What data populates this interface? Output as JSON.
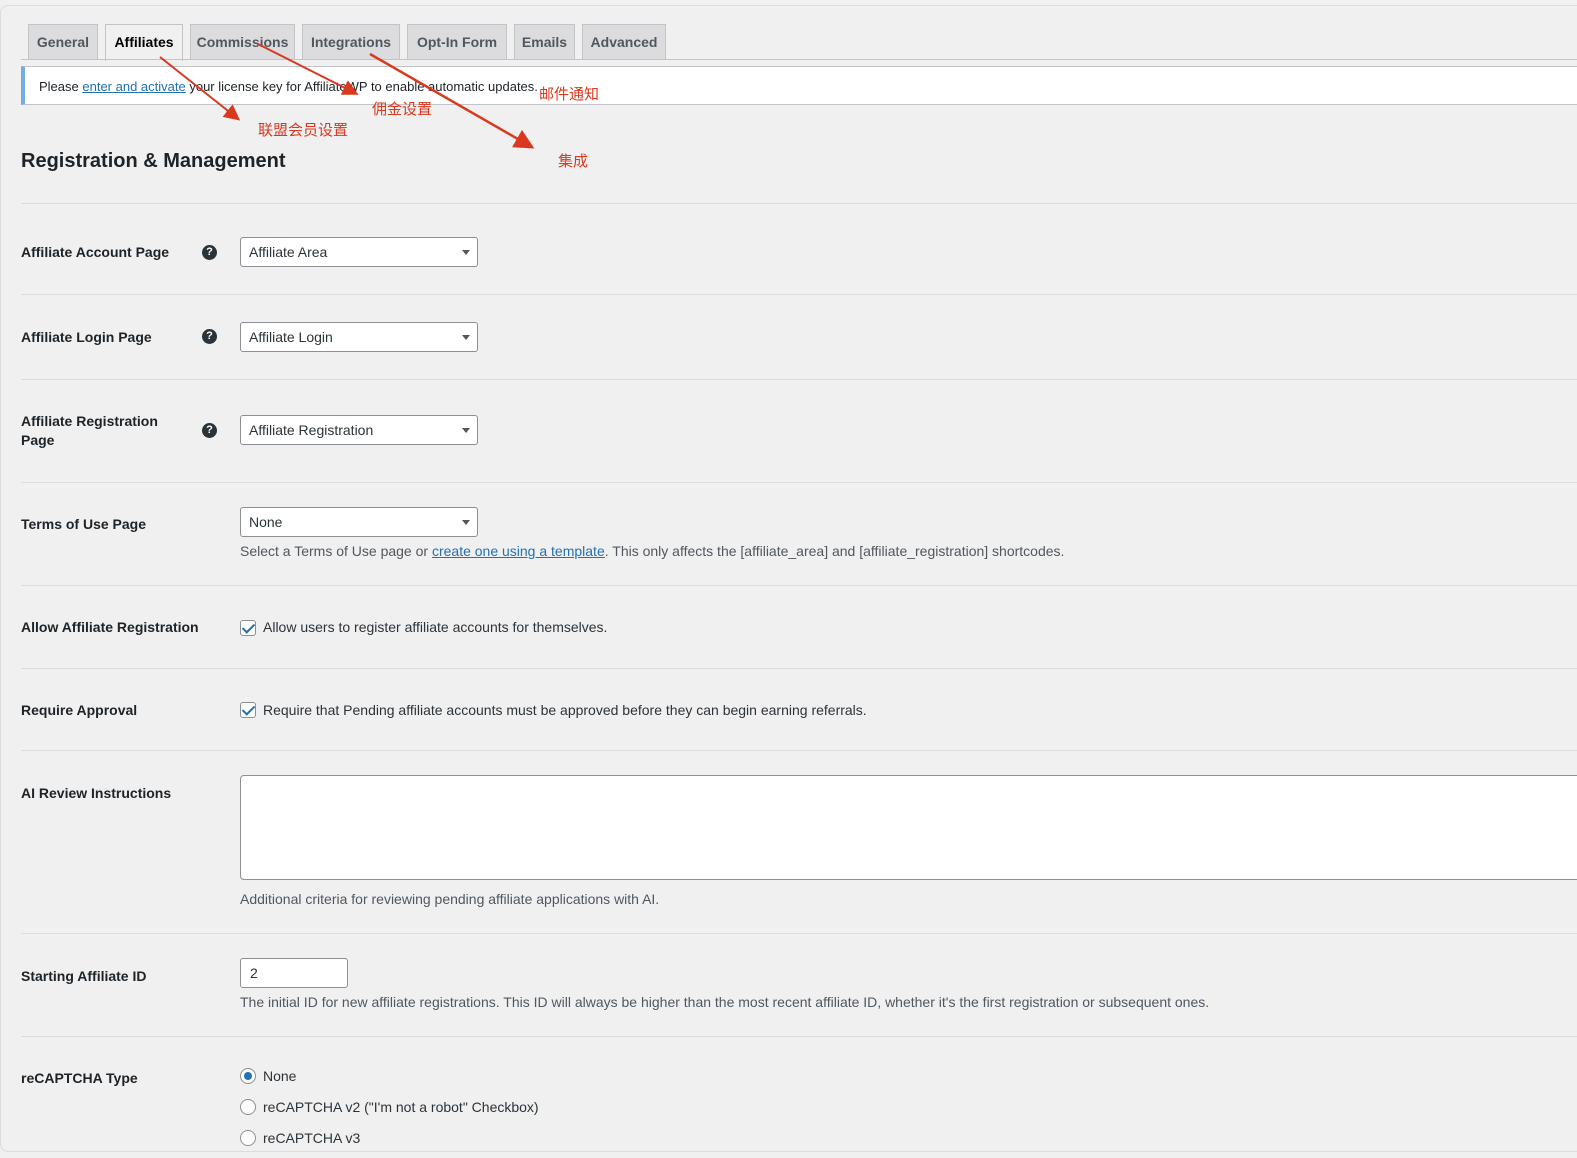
{
  "tabs": [
    {
      "label": "General"
    },
    {
      "label": "Affiliates",
      "active": true
    },
    {
      "label": "Commissions"
    },
    {
      "label": "Integrations"
    },
    {
      "label": "Opt-In Form"
    },
    {
      "label": "Emails"
    },
    {
      "label": "Advanced"
    }
  ],
  "notice": {
    "prefix": "Please ",
    "link": "enter and activate",
    "suffix": " your license key for AffiliateWP to enable automatic updates."
  },
  "annotations": {
    "affiliates": "联盟会员设置",
    "commissions": "佣金设置",
    "emails": "邮件通知",
    "integrations": "集成"
  },
  "section_title": "Registration & Management",
  "fields": {
    "account_page": {
      "label": "Affiliate Account Page",
      "value": "Affiliate Area"
    },
    "login_page": {
      "label": "Affiliate Login Page",
      "value": "Affiliate Login"
    },
    "registration_page": {
      "label_line1": "Affiliate Registration",
      "label_line2": "Page",
      "value": "Affiliate Registration"
    },
    "terms_page": {
      "label": "Terms of Use Page",
      "value": "None",
      "desc_prefix": "Select a Terms of Use page or ",
      "desc_link": "create one using a template",
      "desc_suffix": ". This only affects the [affiliate_area] and [affiliate_registration] shortcodes."
    },
    "allow_registration": {
      "label": "Allow Affiliate Registration",
      "checked": true,
      "text": "Allow users to register affiliate accounts for themselves."
    },
    "require_approval": {
      "label": "Require Approval",
      "checked": true,
      "text": "Require that Pending affiliate accounts must be approved before they can begin earning referrals."
    },
    "ai_review": {
      "label": "AI Review Instructions",
      "value": "",
      "desc": "Additional criteria for reviewing pending affiliate applications with AI."
    },
    "starting_id": {
      "label": "Starting Affiliate ID",
      "value": "2",
      "desc": "The initial ID for new affiliate registrations. This ID will always be higher than the most recent affiliate ID, whether it's the first registration or subsequent ones."
    },
    "recaptcha": {
      "label": "reCAPTCHA Type",
      "options": [
        "None",
        "reCAPTCHA v2 (\"I'm not a robot\" Checkbox)",
        "reCAPTCHA v3"
      ],
      "selected": "None"
    }
  },
  "colors": {
    "accent": "#2271b1",
    "annotation": "#d9391f",
    "notice_border": "#72aee6"
  }
}
